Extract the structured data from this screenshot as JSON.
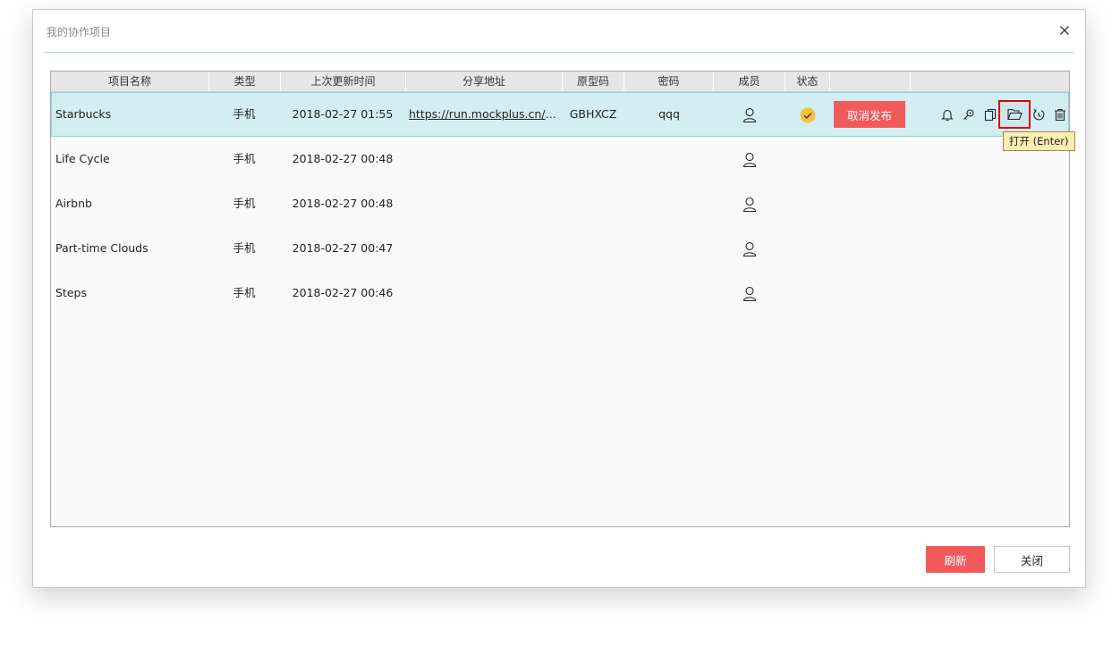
{
  "dialog": {
    "title": "我的协作项目",
    "close_icon": "close-icon"
  },
  "table": {
    "headers": [
      "项目名称",
      "类型",
      "上次更新时间",
      "分享地址",
      "原型码",
      "密码",
      "成员",
      "状态",
      "",
      ""
    ],
    "rows": [
      {
        "name": "Starbucks",
        "type": "手机",
        "updated": "2018-02-27 01:55",
        "url": "https://run.mockplus.cn/E...",
        "code": "GBHXCZ",
        "password": "qqq",
        "member_icon": "user-icon",
        "status_icon": "check-circle-icon",
        "action_button": "取消发布",
        "selected": true
      },
      {
        "name": "Life Cycle",
        "type": "手机",
        "updated": "2018-02-27 00:48",
        "member_icon": "user-icon"
      },
      {
        "name": "Airbnb",
        "type": "手机",
        "updated": "2018-02-27 00:48",
        "member_icon": "user-icon"
      },
      {
        "name": "Part-time Clouds",
        "type": "手机",
        "updated": "2018-02-27 00:47",
        "member_icon": "user-icon"
      },
      {
        "name": "Steps",
        "type": "手机",
        "updated": "2018-02-27 00:46",
        "member_icon": "user-icon"
      }
    ],
    "row_actions": [
      "bell-icon",
      "key-icon",
      "copy-icon",
      "folder-open-icon",
      "history-icon",
      "trash-icon"
    ]
  },
  "tooltip": {
    "text": "打开 (Enter)"
  },
  "footer": {
    "refresh_label": "刷新",
    "close_label": "关闭"
  },
  "colors": {
    "accent_red": "#f05a5b",
    "selected_row": "#d3eef3",
    "status_yellow": "#f5c23a",
    "tooltip_bg": "#fdedaf"
  }
}
